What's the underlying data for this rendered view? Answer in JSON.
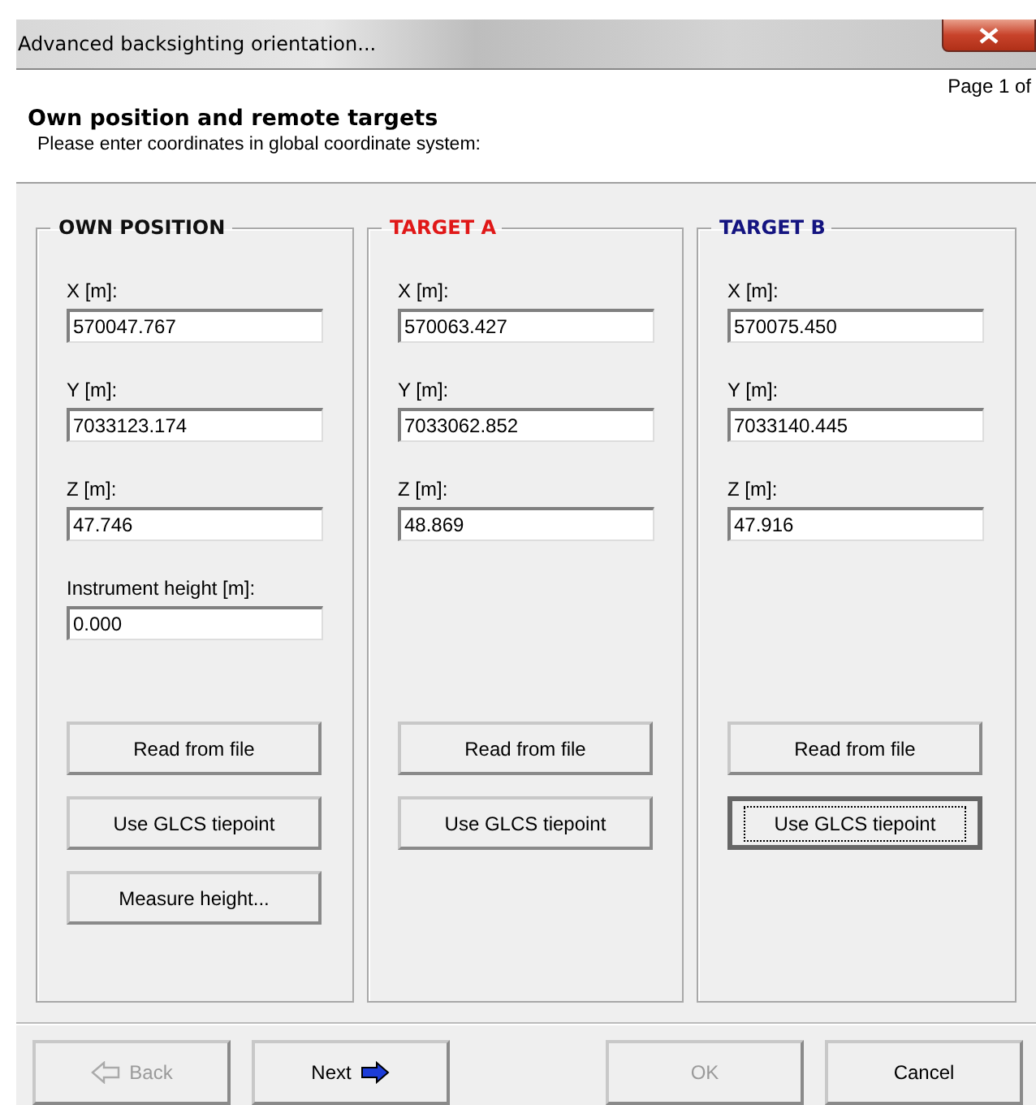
{
  "window": {
    "title": "Advanced backsighting orientation..."
  },
  "page_indicator": "Page 1 of",
  "heading": "Own position and remote targets",
  "subheading": "Please enter coordinates in global coordinate system:",
  "panels": [
    {
      "title": "OWN POSITION",
      "color": "#101010",
      "fields": [
        {
          "label": "X [m]:",
          "value": "570047.767"
        },
        {
          "label": "Y [m]:",
          "value": "7033123.174"
        },
        {
          "label": "Z [m]:",
          "value": "47.746"
        },
        {
          "label": "Instrument height [m]:",
          "value": "0.000"
        }
      ],
      "buttons": [
        {
          "label": "Read from file",
          "focused": false
        },
        {
          "label": "Use GLCS tiepoint",
          "focused": false
        },
        {
          "label": "Measure height...",
          "focused": false
        }
      ]
    },
    {
      "title": "TARGET A",
      "color": "#e01818",
      "fields": [
        {
          "label": "X [m]:",
          "value": "570063.427"
        },
        {
          "label": "Y [m]:",
          "value": "7033062.852"
        },
        {
          "label": "Z [m]:",
          "value": "48.869"
        }
      ],
      "buttons": [
        {
          "label": "Read from file",
          "focused": false
        },
        {
          "label": "Use GLCS tiepoint",
          "focused": false
        }
      ]
    },
    {
      "title": "TARGET B",
      "color": "#141480",
      "fields": [
        {
          "label": "X [m]:",
          "value": "570075.450"
        },
        {
          "label": "Y [m]:",
          "value": "7033140.445"
        },
        {
          "label": "Z [m]:",
          "value": "47.916"
        }
      ],
      "buttons": [
        {
          "label": "Read from file",
          "focused": false
        },
        {
          "label": "Use GLCS tiepoint",
          "focused": true
        }
      ]
    }
  ],
  "footer_buttons": [
    {
      "label": "Back",
      "kind": "back",
      "disabled": true
    },
    {
      "label": "Next",
      "kind": "next",
      "disabled": false
    },
    {
      "label": "OK",
      "kind": "plain",
      "disabled": true
    },
    {
      "label": "Cancel",
      "kind": "plain",
      "disabled": false
    }
  ]
}
